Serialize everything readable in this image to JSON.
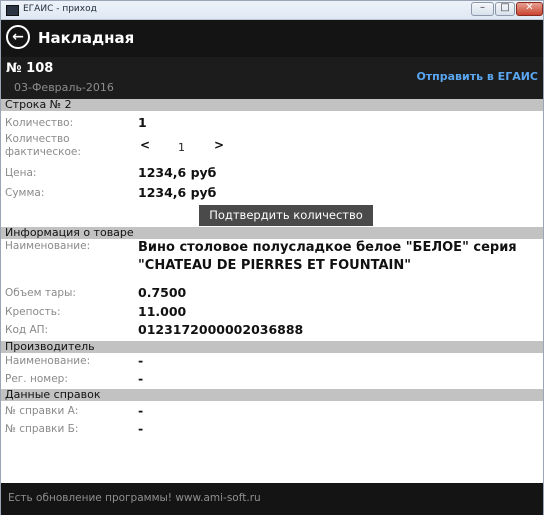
{
  "window": {
    "title": "ЕГАИС - приход"
  },
  "header": {
    "title": "Накладная"
  },
  "document": {
    "number": "№ 108",
    "date": "03-Февраль-2016",
    "send_label": "Отправить в ЕГАИС"
  },
  "row_section": {
    "title": "Строка № 2",
    "quantity_label": "Количество:",
    "quantity_value": "1",
    "actual_label_line1": "Количество",
    "actual_label_line2": "фактическое:",
    "stepper_prev": "<",
    "actual_value": "1",
    "stepper_next": ">",
    "price_label": "Цена:",
    "price_value": "1234,6 руб",
    "sum_label": "Сумма:",
    "sum_value": "1234,6 руб",
    "confirm_label": "Подтвердить количество"
  },
  "product_section": {
    "title": "Информация о товаре",
    "name_label": "Наименование:",
    "name_value": "Вино столовое полусладкое белое \"БЕЛОЕ\" серия \"CHATEAU DE PIERRES ET FOUNTAIN\"",
    "volume_label": "Объем тары:",
    "volume_value": "0.7500",
    "strength_label": "Крепость:",
    "strength_value": "11.000",
    "code_label": "Код АП:",
    "code_value": "0123172000002036888"
  },
  "producer_section": {
    "title": "Производитель",
    "name_label": "Наименование:",
    "name_value": "-",
    "reg_label": "Рег. номер:",
    "reg_value": "-"
  },
  "certs_section": {
    "title": "Данные справок",
    "a_label": "№ справки А:",
    "a_value": "-",
    "b_label": "№ справки Б:",
    "b_value": "-"
  },
  "footer": {
    "text": "Есть обновление программы! www.ami-soft.ru"
  }
}
